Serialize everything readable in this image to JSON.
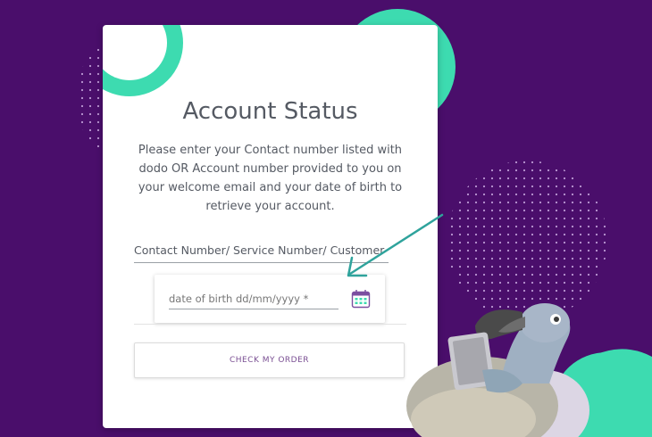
{
  "card": {
    "title": "Account Status",
    "description": "Please enter your Contact number listed with dodo OR Account number provided to you on your welcome email and your date of birth to retrieve your account.",
    "contact_placeholder": "Contact Number/ Service Number/ Customer Id",
    "dob_placeholder": "date of birth dd/mm/yyyy *",
    "check_button_label": "CHECK MY ORDER"
  },
  "colors": {
    "background": "#4a0e6b",
    "accent_teal": "#3ddbb0",
    "button_text": "#7a4f93",
    "calendar_icon": "#7b4fa0"
  },
  "icons": {
    "calendar": "calendar-icon",
    "arrow": "pointer-arrow-icon",
    "mascot": "dodo-bird-mascot"
  }
}
